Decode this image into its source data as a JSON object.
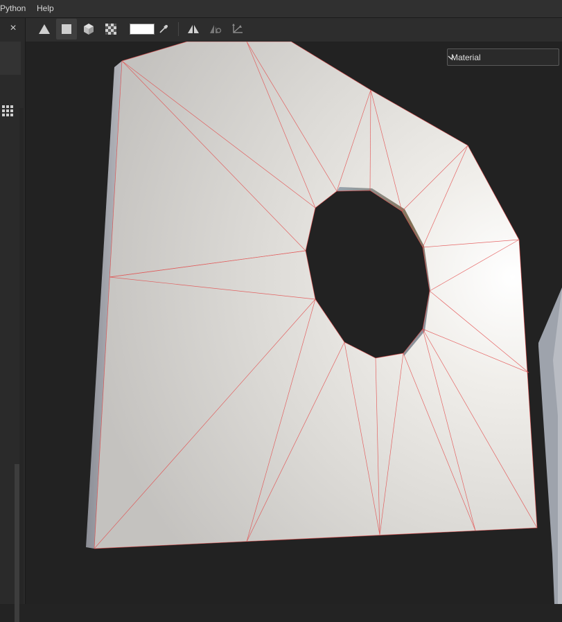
{
  "menu": {
    "python": "Python",
    "help": "Help"
  },
  "left_panel": {
    "close_glyph": "×"
  },
  "toolbar": {
    "tools": [
      {
        "icon": "triangle-icon"
      },
      {
        "icon": "square-icon"
      },
      {
        "icon": "cube-icon"
      },
      {
        "icon": "checker-icon"
      }
    ],
    "paint_color": "#ffffff",
    "eyedropper_icon": "eyedropper-icon",
    "symmetry_icon": "symmetry-icon",
    "symmetry_settings_icon": "symmetry-settings-icon",
    "transform_icon": "transform-icon"
  },
  "viewport": {
    "display_mode": "Material",
    "wireframe_color": "#e34c4c"
  }
}
